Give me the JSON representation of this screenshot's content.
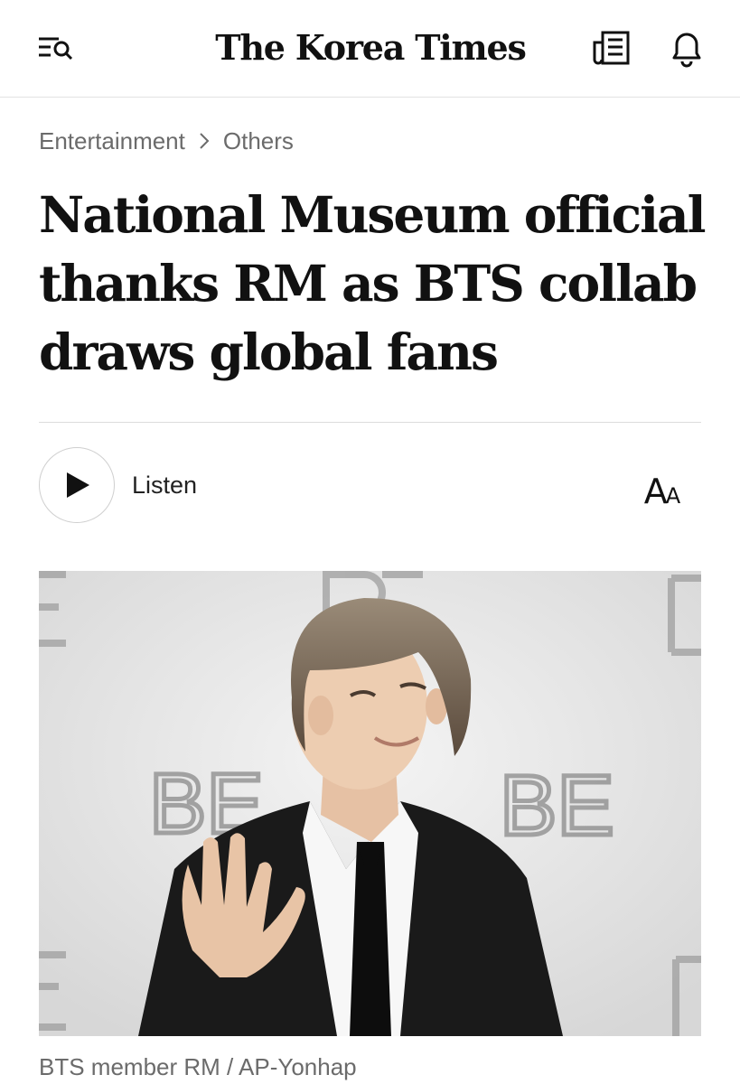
{
  "header": {
    "logo": "The Korea Times",
    "menu_icon": "menu-search-icon",
    "newspaper_icon": "newspaper-icon",
    "bell_icon": "bell-icon"
  },
  "breadcrumb": {
    "section": "Entertainment",
    "subsection": "Others",
    "separator_icon": "chevron-right-icon"
  },
  "article": {
    "headline_lines": [
      "National Museum official",
      "thanks RM as BTS collab",
      "draws global fans"
    ],
    "listen_label": "Listen",
    "font_size_glyph_big": "A",
    "font_size_glyph_small": "A",
    "photo_backdrop_text": "BE",
    "photo_caption": "BTS member RM / AP-Yonhap"
  },
  "colors": {
    "text": "#111111",
    "muted": "#6b6b6b",
    "divider": "#dcdcdc"
  }
}
